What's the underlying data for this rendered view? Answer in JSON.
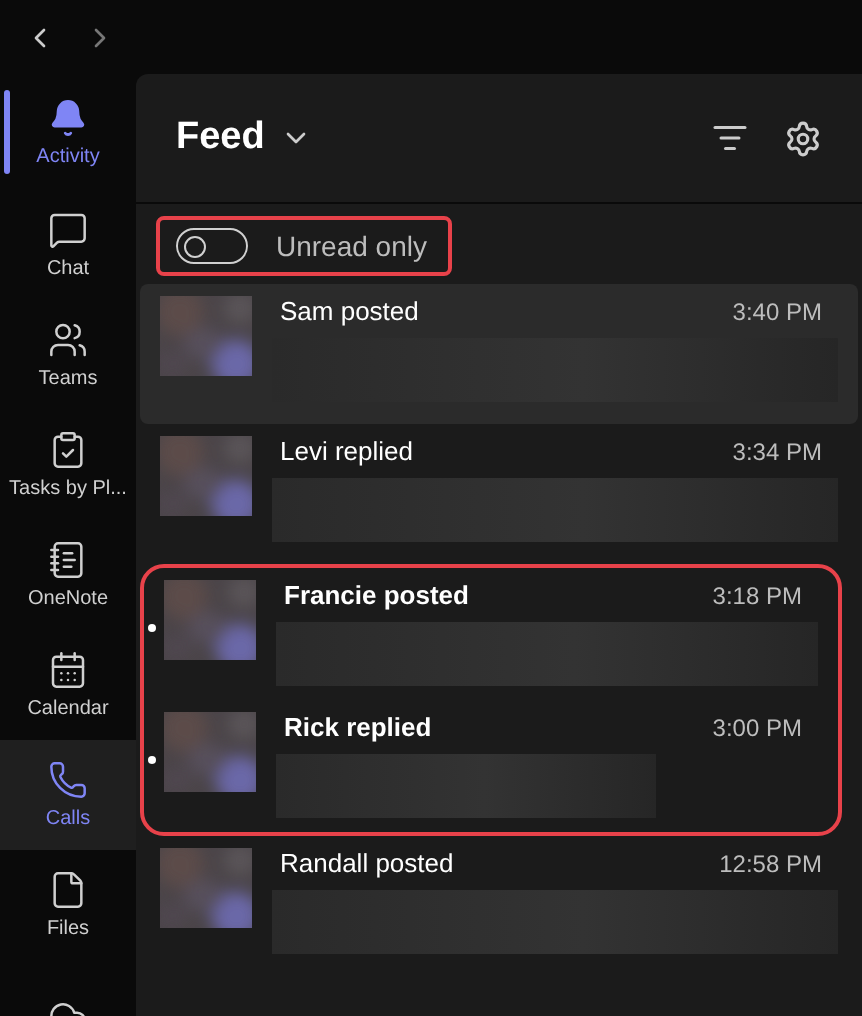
{
  "rail": {
    "items": [
      {
        "label": "Activity",
        "selected": true,
        "highlighted": false
      },
      {
        "label": "Chat",
        "selected": false,
        "highlighted": false
      },
      {
        "label": "Teams",
        "selected": false,
        "highlighted": false
      },
      {
        "label": "Tasks by Pl...",
        "selected": false,
        "highlighted": false
      },
      {
        "label": "OneNote",
        "selected": false,
        "highlighted": false
      },
      {
        "label": "Calendar",
        "selected": false,
        "highlighted": false
      },
      {
        "label": "Calls",
        "selected": false,
        "highlighted": true
      },
      {
        "label": "Files",
        "selected": false,
        "highlighted": false
      }
    ]
  },
  "feed": {
    "title": "Feed",
    "toggle": {
      "label": "Unread only",
      "on": false,
      "outlined": true
    },
    "items": [
      {
        "title": "Sam posted",
        "time": "3:40 PM",
        "unread": false,
        "selected": true,
        "outlined": false
      },
      {
        "title": "Levi replied",
        "time": "3:34 PM",
        "unread": false,
        "selected": false,
        "outlined": false
      },
      {
        "title": "Francie posted",
        "time": "3:18 PM",
        "unread": true,
        "selected": false,
        "outlined": true
      },
      {
        "title": "Rick replied",
        "time": "3:00 PM",
        "unread": true,
        "selected": false,
        "outlined": true
      },
      {
        "title": "Randall posted",
        "time": "12:58 PM",
        "unread": false,
        "selected": false,
        "outlined": false
      }
    ]
  }
}
